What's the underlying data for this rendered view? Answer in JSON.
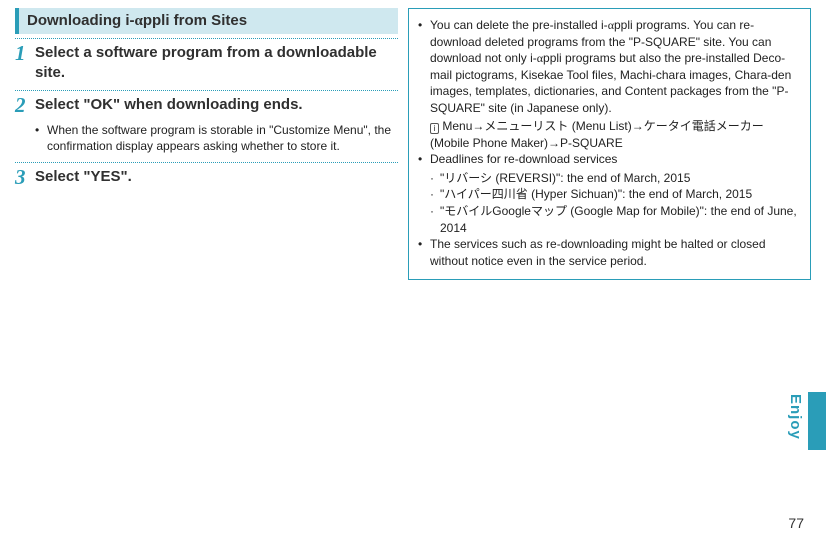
{
  "header": {
    "title_pre": "Downloading i-",
    "title_alpha": "α",
    "title_post": "ppli from Sites"
  },
  "steps": [
    {
      "num": "1",
      "text": "Select a software program from a downloadable site.",
      "subs": []
    },
    {
      "num": "2",
      "text": "Select \"OK\" when downloading ends.",
      "subs": [
        "When the software program is storable in \"Customize Menu\", the confirmation display appears asking whether to store it."
      ]
    },
    {
      "num": "3",
      "text": "Select \"YES\".",
      "subs": []
    }
  ],
  "notes": {
    "b1": {
      "pre": "You can delete the pre-installed i-",
      "alpha1": "α",
      "mid1": "ppli programs. You can re-download deleted programs from the \"P-SQUARE\" site. You can download not only i-",
      "alpha2": "α",
      "post": "ppli programs but also the pre-installed Deco-mail pictograms, Kisekae Tool files, Machi-chara images, Chara-den images, templates, dictionaries, and Content packages from the \"P-SQUARE\" site (in Japanese only)."
    },
    "b1_path": "Menu→メニューリスト (Menu List)→ケータイ電話メーカー (Mobile Phone Maker)→P-SQUARE",
    "b2": "Deadlines for re-download services",
    "b2_items": [
      "\"リバーシ (REVERSI)\": the end of March, 2015",
      "\"ハイパー四川省 (Hyper Sichuan)\": the end of March, 2015",
      "\"モバイルGoogleマップ (Google Map for Mobile)\": the end of June, 2014"
    ],
    "b3": "The services such as re-downloading might be halted or closed without notice even in the service period."
  },
  "side_label": "Enjoy",
  "page_number": "77"
}
